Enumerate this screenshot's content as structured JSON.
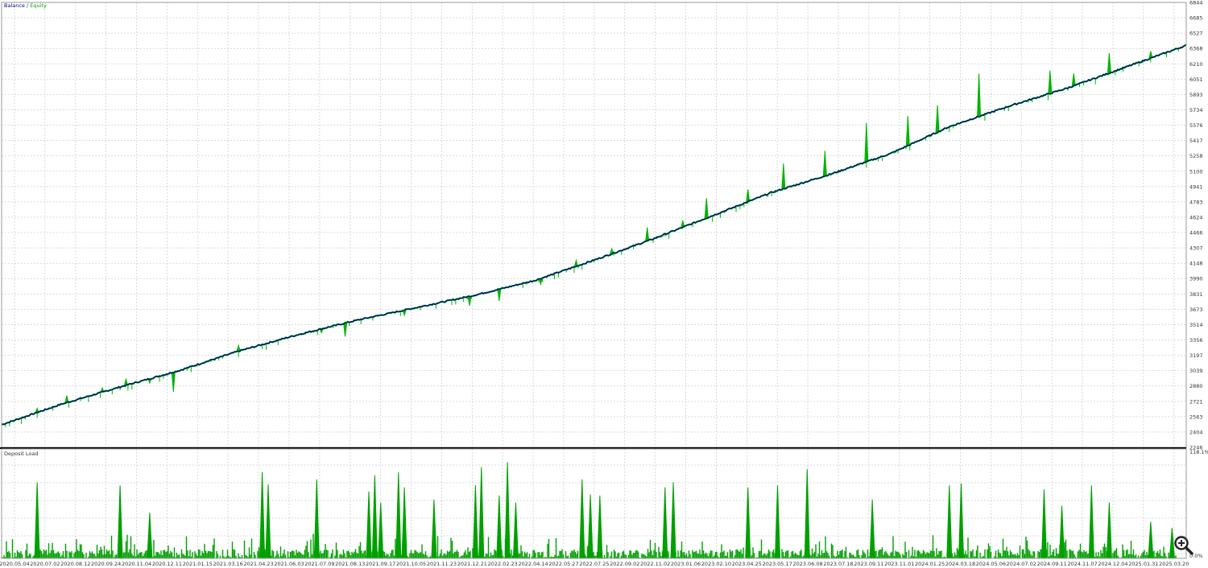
{
  "chart_data": [
    {
      "type": "line",
      "legend": {
        "balance_label": "Balance",
        "separator": " / ",
        "equity_label": "Equity",
        "position": "top-left"
      },
      "colors": {
        "balance": "#00008b",
        "equity": "#00b400",
        "grid": "#d0d0d0",
        "frame": "#000000"
      },
      "grid": true,
      "ylim": [
        2246,
        6844
      ],
      "y_ticks": [
        "2246",
        "2404",
        "2563",
        "2721",
        "2880",
        "3039",
        "3197",
        "3356",
        "3514",
        "3673",
        "3831",
        "3990",
        "4148",
        "4307",
        "4466",
        "4624",
        "4783",
        "4941",
        "5100",
        "5258",
        "5417",
        "5576",
        "5734",
        "5893",
        "6051",
        "6210",
        "6368",
        "6527",
        "6685",
        "6844"
      ],
      "x_ticks": [
        "2020.05.04",
        "2020.07.02",
        "2020.08.12",
        "2020.09.24",
        "2020.11.04",
        "2020.12.11",
        "2021.01.15",
        "2021.03.16",
        "2021.04.23",
        "2021.06.03",
        "2021.07.09",
        "2021.08.13",
        "2021.09.17",
        "2021.10.05",
        "2021.11.23",
        "2021.12.21",
        "2022.02.23",
        "2022.04.14",
        "2022.05.27",
        "2022.07.25",
        "2022.09.02",
        "2022.11.02",
        "2023.01.06",
        "2023.02.10",
        "2023.04.25",
        "2023.05.17",
        "2023.06.08",
        "2023.07.18",
        "2023.09.11",
        "2023.11.01",
        "2024.01.25",
        "2024.03.18",
        "2024.05.06",
        "2024.07.02",
        "2024.09.11",
        "2024.11.07",
        "2024.12.04",
        "2025.01.31",
        "2025.03.20"
      ],
      "series": [
        {
          "name": "Balance",
          "x": [
            0,
            0.05,
            0.1,
            0.15,
            0.2,
            0.25,
            0.3,
            0.35,
            0.4,
            0.45,
            0.5,
            0.55,
            0.6,
            0.65,
            0.7,
            0.75,
            0.8,
            0.85,
            0.9,
            0.95,
            1.0
          ],
          "values": [
            2480,
            2690,
            2870,
            3040,
            3240,
            3410,
            3560,
            3690,
            3820,
            3970,
            4180,
            4400,
            4640,
            4880,
            5070,
            5280,
            5560,
            5770,
            5960,
            6180,
            6400
          ]
        },
        {
          "name": "Equity",
          "x": [
            0.03,
            0.055,
            0.085,
            0.105,
            0.125,
            0.145,
            0.2,
            0.27,
            0.29,
            0.34,
            0.395,
            0.42,
            0.455,
            0.485,
            0.515,
            0.545,
            0.575,
            0.595,
            0.63,
            0.66,
            0.695,
            0.73,
            0.765,
            0.79,
            0.825,
            0.865,
            0.885,
            0.905,
            0.935,
            0.97
          ],
          "drawdowns": [
            2650,
            2780,
            2860,
            2950,
            2910,
            2820,
            3300,
            3430,
            3390,
            3610,
            3710,
            3760,
            3930,
            4180,
            4300,
            4520,
            4590,
            4820,
            4910,
            5180,
            5310,
            5600,
            5670,
            5780,
            6110,
            5820,
            6140,
            6110,
            6320,
            6340
          ]
        }
      ]
    },
    {
      "type": "area",
      "title": "Deposit Load",
      "color": "#00a000",
      "ylim_labels": [
        "118.1%",
        "0.0%"
      ],
      "peaks": [
        {
          "x": 0.03,
          "value": 0.75
        },
        {
          "x": 0.1,
          "value": 0.72
        },
        {
          "x": 0.125,
          "value": 0.45
        },
        {
          "x": 0.22,
          "value": 0.85
        },
        {
          "x": 0.225,
          "value": 0.73
        },
        {
          "x": 0.266,
          "value": 0.78
        },
        {
          "x": 0.31,
          "value": 0.66
        },
        {
          "x": 0.315,
          "value": 0.82
        },
        {
          "x": 0.32,
          "value": 0.55
        },
        {
          "x": 0.335,
          "value": 0.85
        },
        {
          "x": 0.34,
          "value": 0.7
        },
        {
          "x": 0.365,
          "value": 0.58
        },
        {
          "x": 0.4,
          "value": 0.72
        },
        {
          "x": 0.405,
          "value": 0.9
        },
        {
          "x": 0.42,
          "value": 0.62
        },
        {
          "x": 0.427,
          "value": 0.95
        },
        {
          "x": 0.434,
          "value": 0.55
        },
        {
          "x": 0.49,
          "value": 0.78
        },
        {
          "x": 0.497,
          "value": 0.63
        },
        {
          "x": 0.505,
          "value": 0.62
        },
        {
          "x": 0.56,
          "value": 0.7
        },
        {
          "x": 0.567,
          "value": 0.75
        },
        {
          "x": 0.63,
          "value": 0.7
        },
        {
          "x": 0.655,
          "value": 0.72
        },
        {
          "x": 0.68,
          "value": 0.88
        },
        {
          "x": 0.735,
          "value": 0.58
        },
        {
          "x": 0.8,
          "value": 0.72
        },
        {
          "x": 0.81,
          "value": 0.74
        },
        {
          "x": 0.88,
          "value": 0.68
        },
        {
          "x": 0.895,
          "value": 0.52
        },
        {
          "x": 0.92,
          "value": 0.72
        },
        {
          "x": 0.935,
          "value": 0.55
        },
        {
          "x": 0.97,
          "value": 0.36
        },
        {
          "x": 0.988,
          "value": 0.3
        }
      ]
    }
  ],
  "controls": {
    "zoom_icon": "magnifier-plus-icon"
  }
}
